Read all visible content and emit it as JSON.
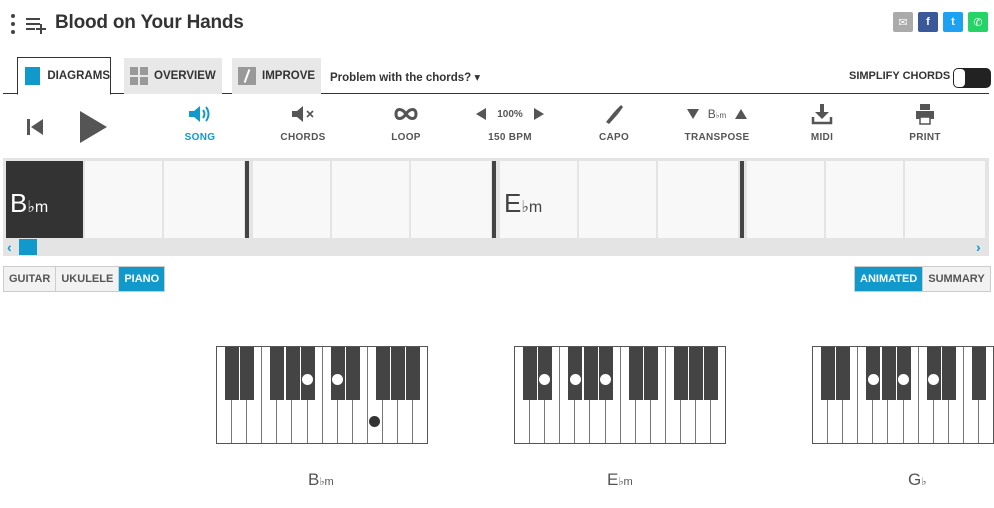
{
  "header": {
    "title": "Blood on Your Hands",
    "share": [
      {
        "name": "email",
        "color": "#aaaaaa",
        "glyph": "✉"
      },
      {
        "name": "facebook",
        "color": "#3b5998",
        "glyph": "f"
      },
      {
        "name": "twitter",
        "color": "#1da1f2",
        "glyph": "t"
      },
      {
        "name": "whatsapp",
        "color": "#25d366",
        "glyph": "✆"
      }
    ]
  },
  "tabs": {
    "diagrams": "DIAGRAMS",
    "overview": "OVERVIEW",
    "improve": "IMPROVE",
    "problem": "Problem with the chords? ▾",
    "simplify": "SIMPLIFY CHORDS"
  },
  "toolbar": {
    "song": "SONG",
    "chords": "CHORDS",
    "loop": "LOOP",
    "zoom": "100%",
    "bpm": "150 BPM",
    "capo": "CAPO",
    "transpose": "TRANSPOSE",
    "transpose_key": {
      "root": "B",
      "acc": "♭m"
    },
    "midi": "MIDI",
    "print": "PRINT"
  },
  "strip": {
    "chords": [
      {
        "root": "B",
        "acc": "♭m"
      },
      {
        "root": "E",
        "acc": "♭m"
      }
    ]
  },
  "instruments": {
    "guitar": "GUITAR",
    "ukulele": "UKULELE",
    "piano": "PIANO"
  },
  "views": {
    "animated": "ANIMATED",
    "summary": "SUMMARY"
  },
  "pianos": [
    {
      "root": "B",
      "acc": "♭m"
    },
    {
      "root": "E",
      "acc": "♭m"
    },
    {
      "root": "G",
      "acc": "♭"
    }
  ],
  "colors": {
    "accent": "#1199cc"
  }
}
